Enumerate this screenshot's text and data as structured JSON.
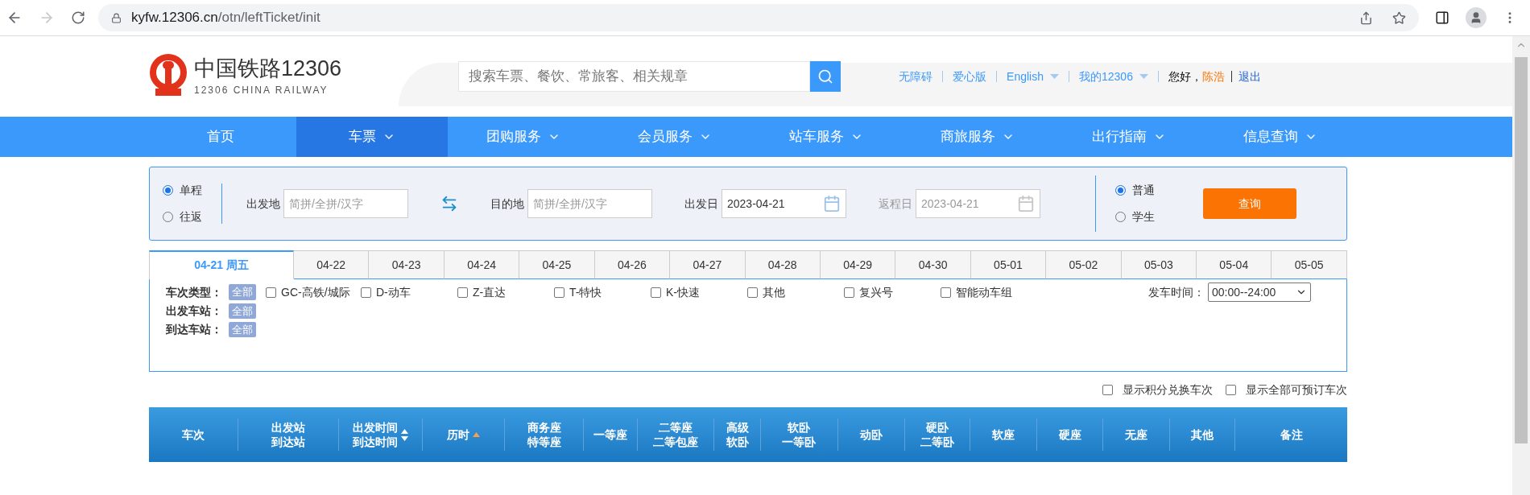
{
  "browser": {
    "url_host": "kyfw.12306.cn",
    "url_path": "/otn/leftTicket/init",
    "forward_disabled": true
  },
  "header": {
    "logo_title": "中国铁路12306",
    "logo_subtitle": "12306 CHINA RAILWAY",
    "search": {
      "placeholder": "搜索车票、餐饮、常旅客、相关规章"
    },
    "links": [
      {
        "label": "无障碍",
        "kind": "link"
      },
      {
        "label": "爱心版",
        "kind": "link"
      },
      {
        "label": "English",
        "kind": "dropdown"
      },
      {
        "label": "我的12306",
        "kind": "dropdown"
      }
    ],
    "greeting": "您好，",
    "user": "陈浩",
    "logout": "退出"
  },
  "nav": [
    {
      "label": "首页",
      "selected": false,
      "dropdown": false
    },
    {
      "label": "车票",
      "selected": true,
      "dropdown": true
    },
    {
      "label": "团购服务",
      "selected": false,
      "dropdown": true
    },
    {
      "label": "会员服务",
      "selected": false,
      "dropdown": true
    },
    {
      "label": "站车服务",
      "selected": false,
      "dropdown": true
    },
    {
      "label": "商旅服务",
      "selected": false,
      "dropdown": true
    },
    {
      "label": "出行指南",
      "selected": false,
      "dropdown": true
    },
    {
      "label": "信息查询",
      "selected": false,
      "dropdown": true
    }
  ],
  "form": {
    "trip": [
      {
        "label": "单程",
        "selected": true
      },
      {
        "label": "往返",
        "selected": false
      }
    ],
    "from": {
      "label": "出发地",
      "placeholder": "简拼/全拼/汉字"
    },
    "to": {
      "label": "目的地",
      "placeholder": "简拼/全拼/汉字"
    },
    "depart": {
      "label": "出发日",
      "value": "2023-04-21",
      "disabled": false
    },
    "return": {
      "label": "返程日",
      "value": "2023-04-21",
      "disabled": true
    },
    "passenger": [
      {
        "label": "普通",
        "selected": true
      },
      {
        "label": "学生",
        "selected": false
      }
    ],
    "submit": "查询"
  },
  "dates": [
    {
      "label": "04-21 周五",
      "selected": true
    },
    {
      "label": "04-22",
      "selected": false
    },
    {
      "label": "04-23",
      "selected": false
    },
    {
      "label": "04-24",
      "selected": false
    },
    {
      "label": "04-25",
      "selected": false
    },
    {
      "label": "04-26",
      "selected": false
    },
    {
      "label": "04-27",
      "selected": false
    },
    {
      "label": "04-28",
      "selected": false
    },
    {
      "label": "04-29",
      "selected": false
    },
    {
      "label": "04-30",
      "selected": false
    },
    {
      "label": "05-01",
      "selected": false
    },
    {
      "label": "05-02",
      "selected": false
    },
    {
      "label": "05-03",
      "selected": false
    },
    {
      "label": "05-04",
      "selected": false
    },
    {
      "label": "05-05",
      "selected": false
    }
  ],
  "filters": {
    "train_type_label": "车次类型：",
    "train_type_all": "全部",
    "train_types": [
      {
        "label": "GC-高铁/城际",
        "checked": false
      },
      {
        "label": "D-动车",
        "checked": false
      },
      {
        "label": "Z-直达",
        "checked": false
      },
      {
        "label": "T-特快",
        "checked": false
      },
      {
        "label": "K-快速",
        "checked": false
      },
      {
        "label": "其他",
        "checked": false
      },
      {
        "label": "复兴号",
        "checked": false
      },
      {
        "label": "智能动车组",
        "checked": false
      }
    ],
    "time_label": "发车时间：",
    "time_value": "00:00--24:00",
    "stations": [
      {
        "label": "出发车站：",
        "all": "全部"
      },
      {
        "label": "到达车站：",
        "all": "全部"
      }
    ]
  },
  "options": [
    {
      "label": "显示积分兑换车次",
      "checked": false
    },
    {
      "label": "显示全部可预订车次",
      "checked": false
    }
  ],
  "table": {
    "columns": [
      {
        "lines": [
          "车次"
        ],
        "kind": "plain"
      },
      {
        "lines": [
          "出发站",
          "到达站"
        ],
        "kind": "plain"
      },
      {
        "lines": [
          "出发时间",
          "到达时间"
        ],
        "kind": "sortable"
      },
      {
        "lines": [
          "历时"
        ],
        "kind": "sorted"
      },
      {
        "lines": [
          "商务座",
          "特等座"
        ],
        "kind": "plain"
      },
      {
        "lines": [
          "一等座"
        ],
        "kind": "plain"
      },
      {
        "lines": [
          "二等座",
          "二等包座"
        ],
        "kind": "plain"
      },
      {
        "lines": [
          "高级",
          "软卧"
        ],
        "kind": "plain"
      },
      {
        "lines": [
          "软卧",
          "一等卧"
        ],
        "kind": "plain"
      },
      {
        "lines": [
          "动卧"
        ],
        "kind": "plain"
      },
      {
        "lines": [
          "硬卧",
          "二等卧"
        ],
        "kind": "plain"
      },
      {
        "lines": [
          "软座"
        ],
        "kind": "plain"
      },
      {
        "lines": [
          "硬座"
        ],
        "kind": "plain"
      },
      {
        "lines": [
          "无座"
        ],
        "kind": "plain"
      },
      {
        "lines": [
          "其他"
        ],
        "kind": "plain"
      },
      {
        "lines": [
          "备注"
        ],
        "kind": "plain"
      }
    ]
  }
}
